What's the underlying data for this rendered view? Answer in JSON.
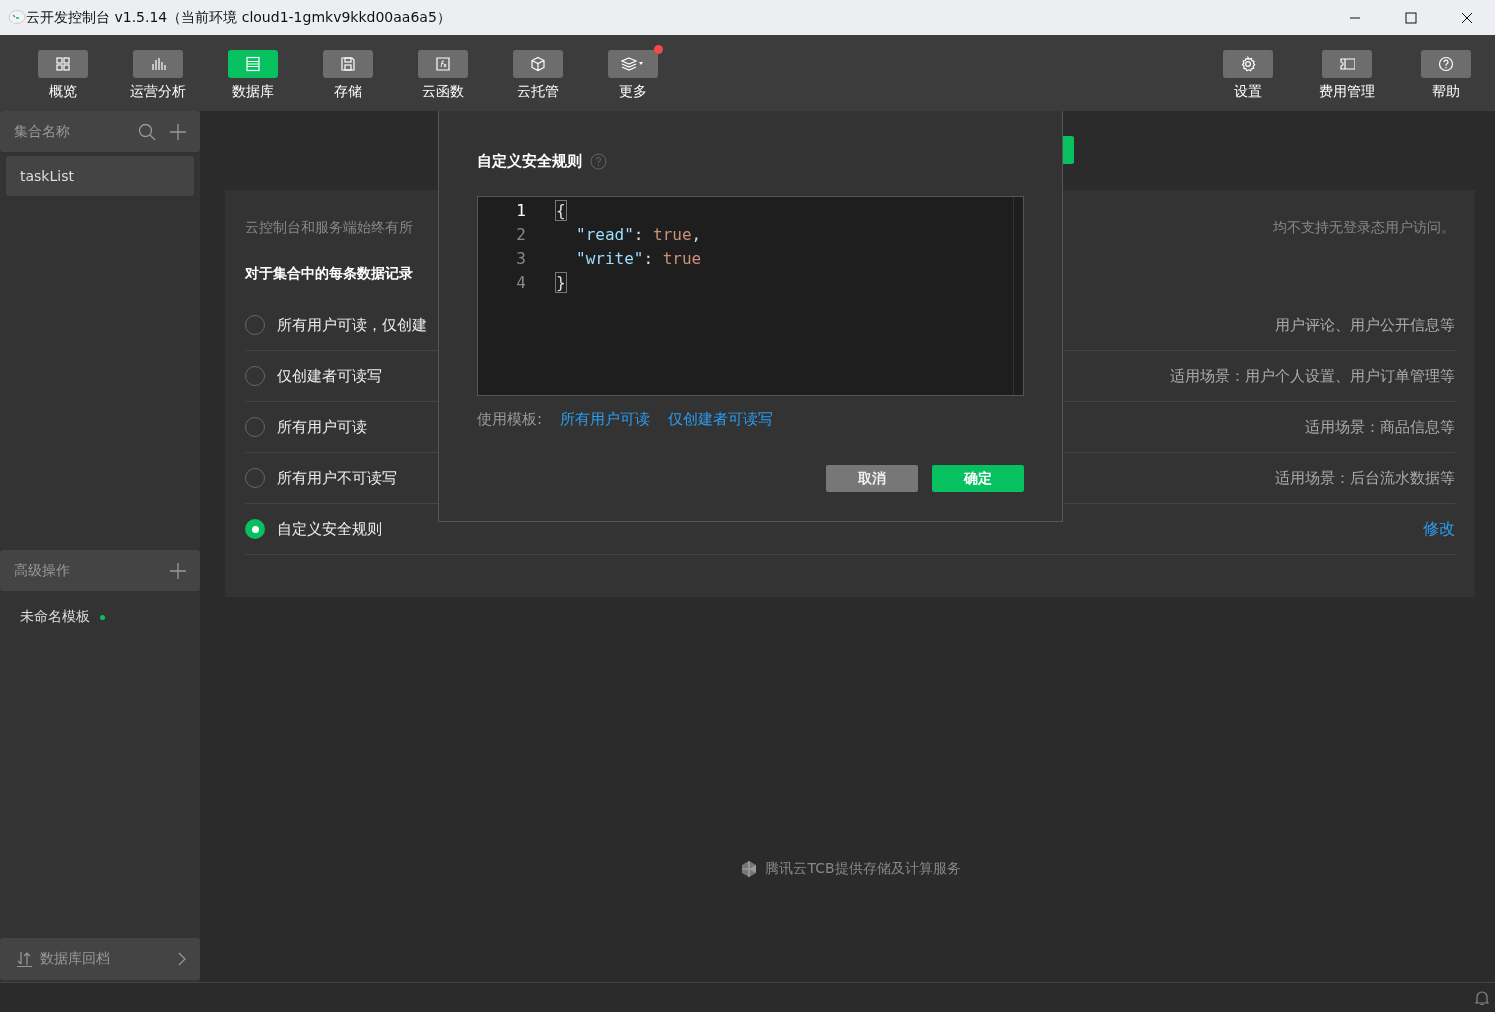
{
  "window": {
    "title": "云开发控制台 v1.5.14（当前环境 cloud1-1gmkv9kkd00aa6a5）"
  },
  "toolbar": {
    "left": [
      {
        "label": "概览",
        "selected": false,
        "badge": false
      },
      {
        "label": "运营分析",
        "selected": false,
        "badge": false
      },
      {
        "label": "数据库",
        "selected": true,
        "badge": false
      },
      {
        "label": "存储",
        "selected": false,
        "badge": false
      },
      {
        "label": "云函数",
        "selected": false,
        "badge": false
      },
      {
        "label": "云托管",
        "selected": false,
        "badge": false
      },
      {
        "label": "更多",
        "selected": false,
        "badge": true
      }
    ],
    "right": [
      {
        "label": "设置",
        "selected": false,
        "badge": false
      },
      {
        "label": "费用管理",
        "selected": false,
        "badge": false
      },
      {
        "label": "帮助",
        "selected": false,
        "badge": false
      }
    ]
  },
  "sidebar": {
    "collections_header": "集合名称",
    "collections": [
      {
        "name": "taskList",
        "selected": true
      }
    ],
    "advanced_header": "高级操作",
    "templates": [
      {
        "name": "未命名模板",
        "color": "#07c160"
      }
    ],
    "rollback": "数据库回档"
  },
  "permissions": {
    "description_left": "云控制台和服务端始终有所",
    "description_right": "均不支持无登录态用户访问。",
    "heading": "对于集合中的每条数据记录",
    "options": [
      {
        "label": "所有用户可读，仅创建",
        "note": "用户评论、用户公开信息等",
        "selected": false
      },
      {
        "label": "仅创建者可读写",
        "note": "适用场景：用户个人设置、用户订单管理等",
        "selected": false
      },
      {
        "label": "所有用户可读",
        "note": "适用场景：商品信息等",
        "selected": false
      },
      {
        "label": "所有用户不可读写",
        "note": "适用场景：后台流水数据等",
        "selected": false
      },
      {
        "label": "自定义安全规则",
        "link": "修改",
        "selected": true
      }
    ]
  },
  "dialog": {
    "title": "自定义安全规则",
    "editor": {
      "lines": [
        {
          "number": "1",
          "active": true,
          "tokens": [
            {
              "kind": "bracket",
              "text": "{"
            }
          ]
        },
        {
          "number": "2",
          "active": false,
          "tokens": [
            {
              "kind": "key",
              "text": "\"read\""
            },
            {
              "kind": "punct",
              "text": ": "
            },
            {
              "kind": "value",
              "text": "true"
            },
            {
              "kind": "punct",
              "text": ","
            }
          ]
        },
        {
          "number": "3",
          "active": false,
          "tokens": [
            {
              "kind": "key",
              "text": "\"write\""
            },
            {
              "kind": "punct",
              "text": ": "
            },
            {
              "kind": "value",
              "text": "true"
            }
          ]
        },
        {
          "number": "4",
          "active": false,
          "tokens": [
            {
              "kind": "bracket",
              "text": "}"
            }
          ]
        }
      ]
    },
    "templates_label": "使用模板:",
    "templates": [
      "所有用户可读",
      "仅创建者可读写"
    ],
    "buttons": [
      {
        "kind": "cancel",
        "label": "取消"
      },
      {
        "kind": "confirm",
        "label": "确定"
      }
    ]
  },
  "footer": "腾讯云TCB提供存储及计算服务"
}
